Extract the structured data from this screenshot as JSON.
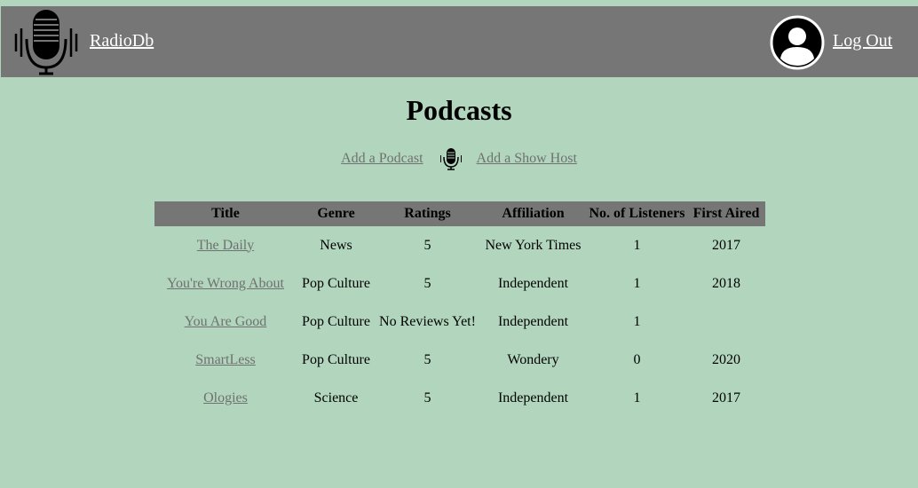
{
  "nav": {
    "brand": "RadioDb",
    "logout": "Log Out"
  },
  "page": {
    "title": "Podcasts",
    "add_podcast": "Add a Podcast",
    "add_host": "Add a Show Host"
  },
  "table": {
    "headers": [
      "Title",
      "Genre",
      "Ratings",
      "Affiliation",
      "No. of Listeners",
      "First Aired"
    ],
    "rows": [
      [
        "The Daily",
        "News",
        "5",
        "New York Times",
        "1",
        "2017"
      ],
      [
        "You're Wrong About",
        "Pop Culture",
        "5",
        "Independent",
        "1",
        "2018"
      ],
      [
        "You Are Good",
        "Pop Culture",
        "No Reviews Yet!",
        "Independent",
        "1",
        ""
      ],
      [
        "SmartLess",
        "Pop Culture",
        "5",
        "Wondery",
        "0",
        "2020"
      ],
      [
        "Ologies",
        "Science",
        "5",
        "Independent",
        "1",
        "2017"
      ]
    ]
  },
  "icons": {
    "logo": "microphone-icon",
    "avatar": "user-avatar-icon",
    "divider": "microphone-icon"
  },
  "colors": {
    "background": "#b1d6bd",
    "navbar": "#767676",
    "link": "#707070"
  }
}
